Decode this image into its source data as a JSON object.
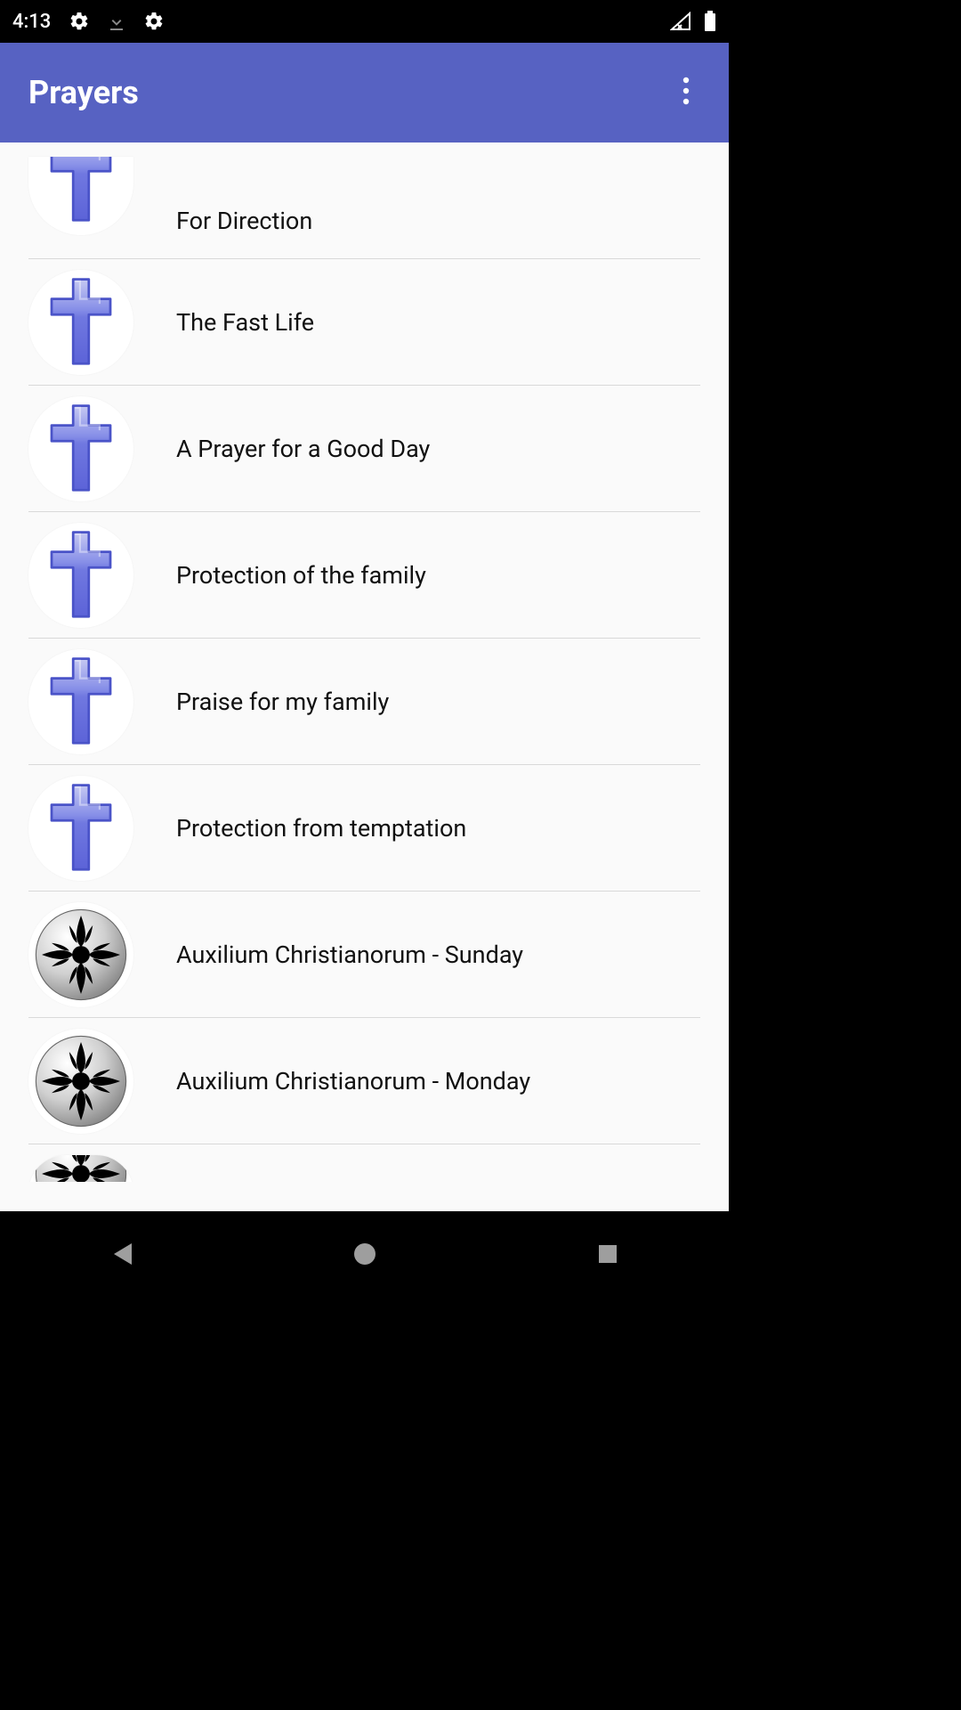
{
  "status_bar": {
    "time": "4:13"
  },
  "app_bar": {
    "title": "Prayers"
  },
  "prayers": [
    {
      "icon": "cross",
      "label": "For Direction",
      "cut": "top"
    },
    {
      "icon": "cross",
      "label": "The Fast Life"
    },
    {
      "icon": "cross",
      "label": "A Prayer for a Good Day"
    },
    {
      "icon": "cross",
      "label": "Protection of the family"
    },
    {
      "icon": "cross",
      "label": "Praise for my family"
    },
    {
      "icon": "cross",
      "label": "Protection from temptation"
    },
    {
      "icon": "fleur",
      "label": "Auxilium Christianorum - Sunday"
    },
    {
      "icon": "fleur",
      "label": "Auxilium Christianorum - Monday"
    },
    {
      "icon": "fleur",
      "label": "",
      "cut": "bottom"
    }
  ]
}
